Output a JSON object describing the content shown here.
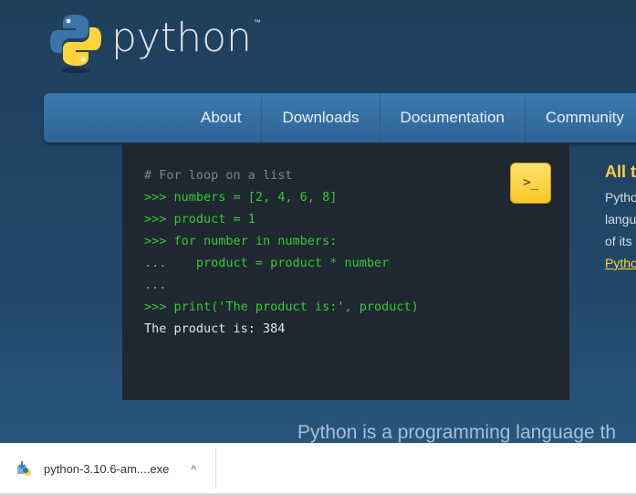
{
  "logo": {
    "wordmark": "python",
    "tm": "™"
  },
  "nav": {
    "items": [
      "About",
      "Downloads",
      "Documentation",
      "Community"
    ]
  },
  "code": {
    "lines": [
      {
        "type": "comment",
        "text": "# For loop on a list"
      },
      {
        "type": "prompt",
        "text": ">>> numbers = [2, 4, 6, 8]"
      },
      {
        "type": "prompt",
        "text": ">>> product = 1"
      },
      {
        "type": "prompt",
        "text": ">>> for number in numbers:"
      },
      {
        "type": "prompt",
        "text": "...    product = product * number"
      },
      {
        "type": "prompt",
        "text": "..."
      },
      {
        "type": "prompt",
        "text": ">>> print('The product is:', product)"
      },
      {
        "type": "out",
        "text": "The product is: 384"
      }
    ],
    "run_label": ">_"
  },
  "side": {
    "heading": "All t",
    "lines": [
      "Pytho",
      "langu",
      "of its"
    ],
    "link": "Pytho"
  },
  "tagline": "Python is a programming language th",
  "download": {
    "filename": "python-3.10.6-am....exe",
    "chevron": "^"
  },
  "colors": {
    "accent": "#ffd43b",
    "prompt": "#37c936",
    "nav": "#3b78ad"
  }
}
